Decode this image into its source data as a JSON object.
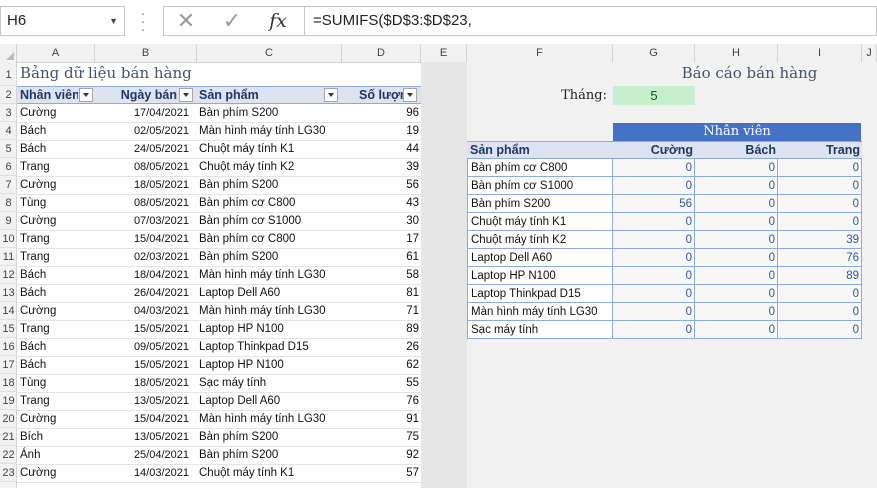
{
  "formula_bar": {
    "name_box": "H6",
    "cancel_icon": "close-icon",
    "enter_icon": "checkmark-icon",
    "fx_label": "fx",
    "formula": "=SUMIFS($D$3:$D$23,"
  },
  "columns": [
    "A",
    "B",
    "C",
    "D",
    "E",
    "F",
    "G",
    "H",
    "I",
    "J"
  ],
  "rows": [
    "1",
    "2",
    "3",
    "4",
    "5",
    "6",
    "7",
    "8",
    "9",
    "10",
    "11",
    "12",
    "13",
    "14",
    "15",
    "16",
    "17",
    "18",
    "19",
    "20",
    "21",
    "22",
    "23"
  ],
  "left_table": {
    "title": "Bảng dữ liệu bán hàng",
    "headers": [
      "Nhân viên",
      "Ngày bán",
      "Sản phẩm",
      "Số lượng"
    ],
    "rows": [
      [
        "Cường",
        "17/04/2021",
        "Bàn phím S200",
        "96"
      ],
      [
        "Bách",
        "02/05/2021",
        "Màn hình máy tính LG30",
        "19"
      ],
      [
        "Bách",
        "24/05/2021",
        "Chuột máy tính K1",
        "44"
      ],
      [
        "Trang",
        "08/05/2021",
        "Chuột máy tính K2",
        "39"
      ],
      [
        "Cường",
        "18/05/2021",
        "Bàn phím S200",
        "56"
      ],
      [
        "Tùng",
        "08/05/2021",
        "Bàn phím cơ C800",
        "43"
      ],
      [
        "Cường",
        "07/03/2021",
        "Bàn phím cơ S1000",
        "30"
      ],
      [
        "Trang",
        "15/04/2021",
        "Bàn phím cơ C800",
        "17"
      ],
      [
        "Trang",
        "02/03/2021",
        "Bàn phím S200",
        "61"
      ],
      [
        "Bách",
        "18/04/2021",
        "Màn hình máy tính LG30",
        "58"
      ],
      [
        "Bách",
        "26/04/2021",
        "Laptop Dell A60",
        "81"
      ],
      [
        "Cường",
        "04/03/2021",
        "Màn hình máy tính LG30",
        "71"
      ],
      [
        "Trang",
        "15/05/2021",
        "Laptop HP N100",
        "89"
      ],
      [
        "Bách",
        "09/05/2021",
        "Laptop Thinkpad D15",
        "26"
      ],
      [
        "Bách",
        "15/05/2021",
        "Laptop HP N100",
        "62"
      ],
      [
        "Tùng",
        "18/05/2021",
        "Sạc máy tính",
        "55"
      ],
      [
        "Trang",
        "13/05/2021",
        "Laptop Dell A60",
        "76"
      ],
      [
        "Cường",
        "15/04/2021",
        "Màn hình máy tính LG30",
        "91"
      ],
      [
        "Bích",
        "13/05/2021",
        "Bàn phím S200",
        "75"
      ],
      [
        "Ánh",
        "25/04/2021",
        "Bàn phím S200",
        "92"
      ],
      [
        "Cường",
        "14/03/2021",
        "Chuột máy tính K1",
        "57"
      ]
    ]
  },
  "report": {
    "title": "Báo cáo bán hàng",
    "month_label": "Tháng:",
    "month_value": "5",
    "staff_header": "Nhân viên",
    "product_header": "Sản phẩm",
    "staff": [
      "Cường",
      "Bách",
      "Trang"
    ],
    "rows": [
      {
        "product": "Bàn phím cơ C800",
        "values": [
          "0",
          "0",
          "0"
        ]
      },
      {
        "product": "Bàn phím cơ S1000",
        "values": [
          "0",
          "0",
          "0"
        ]
      },
      {
        "product": "Bàn phím S200",
        "values": [
          "56",
          "0",
          "0"
        ]
      },
      {
        "product": "Chuột máy tính K1",
        "values": [
          "0",
          "0",
          "0"
        ]
      },
      {
        "product": "Chuột máy tính K2",
        "values": [
          "0",
          "0",
          "39"
        ]
      },
      {
        "product": "Laptop Dell A60",
        "values": [
          "0",
          "0",
          "76"
        ]
      },
      {
        "product": "Laptop HP N100",
        "values": [
          "0",
          "0",
          "89"
        ]
      },
      {
        "product": "Laptop Thinkpad D15",
        "values": [
          "0",
          "0",
          "0"
        ]
      },
      {
        "product": "Màn hình máy tính LG30",
        "values": [
          "0",
          "0",
          "0"
        ]
      },
      {
        "product": "Sạc máy tính",
        "values": [
          "0",
          "0",
          "0"
        ]
      }
    ]
  },
  "colors": {
    "header_fill": "#dde3f1",
    "header_text": "#1f3864",
    "accent_blue": "#4472c4",
    "month_fill": "#c6efce",
    "month_text": "#006100",
    "title_text": "#44546a"
  }
}
